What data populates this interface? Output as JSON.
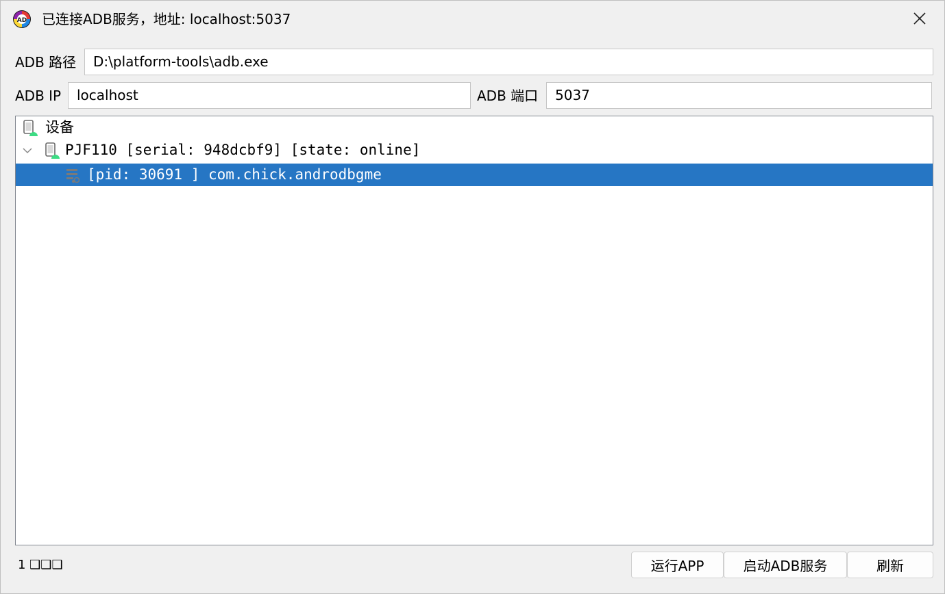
{
  "window": {
    "title": "已连接ADB服务，地址: localhost:5037",
    "icon": "adb-app-icon",
    "close_icon": "close-icon"
  },
  "form": {
    "adb_path_label": "ADB 路径",
    "adb_path_value": "D:\\platform-tools\\adb.exe",
    "adb_ip_label": "ADB IP",
    "adb_ip_value": "localhost",
    "adb_port_label": "ADB 端口",
    "adb_port_value": "5037"
  },
  "tree": {
    "root": {
      "label": "设备",
      "icon": "android-device-icon"
    },
    "device": {
      "label": "PJF110 [serial: 948dcbf9] [state: online]",
      "icon": "android-device-icon",
      "expander_icon": "chevron-down-icon",
      "expanded": true
    },
    "process": {
      "label": "[pid: 30691 ] com.chick.androdbgme",
      "icon": "process-icon",
      "selected": true
    }
  },
  "status": {
    "text": "1 ❑❑❑"
  },
  "buttons": {
    "run_app": "运行APP",
    "start_adb": "启动ADB服务",
    "refresh": "刷新"
  },
  "colors": {
    "selection": "#2676c4",
    "android_green": "#3ddc84"
  }
}
